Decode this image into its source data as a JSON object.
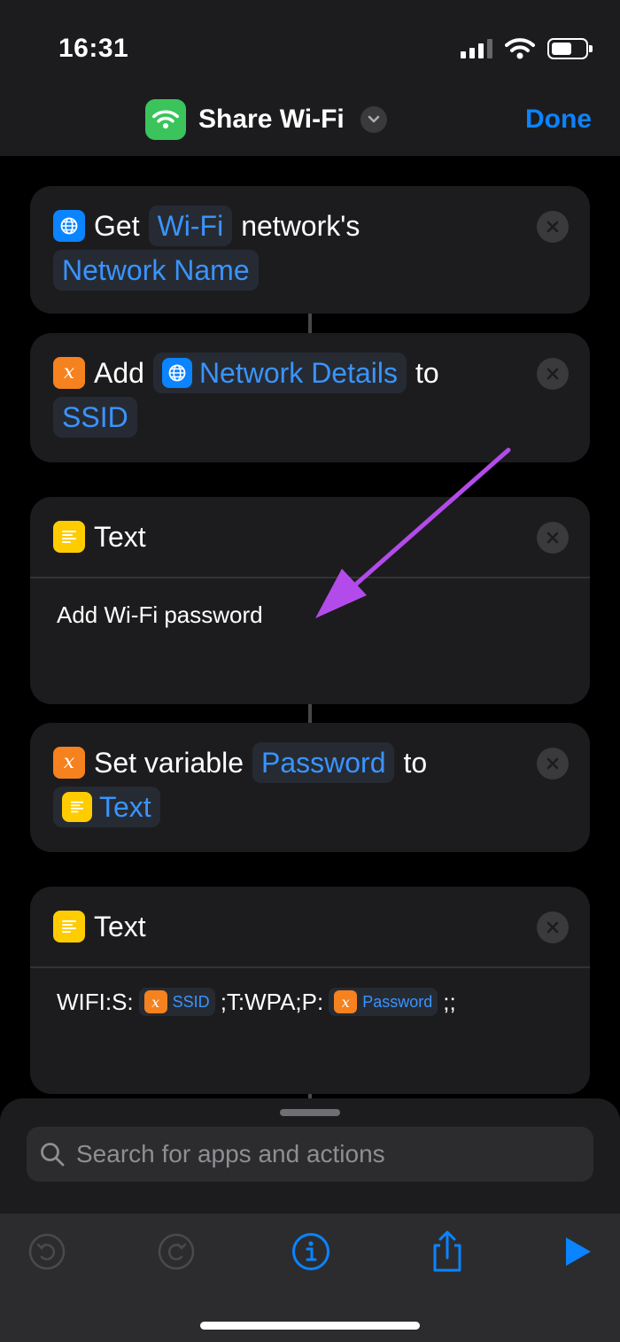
{
  "status": {
    "time": "16:31"
  },
  "nav": {
    "title": "Share Wi-Fi",
    "done_label": "Done"
  },
  "actions": [
    {
      "verb": "Get",
      "token1": "Wi-Fi",
      "mid": "network's",
      "token2": "Network Name"
    },
    {
      "verb": "Add",
      "token1": "Network Details",
      "mid": "to",
      "token2": "SSID"
    },
    {
      "title": "Text",
      "body": "Add Wi-Fi password"
    },
    {
      "verb": "Set variable",
      "token1": "Password",
      "mid": "to",
      "token2": "Text"
    },
    {
      "title": "Text",
      "body_prefix": "WIFI:S:",
      "body_var1": "SSID",
      "body_mid": ";T:WPA;P:",
      "body_var2": "Password",
      "body_suffix": ";;"
    }
  ],
  "search": {
    "placeholder": "Search for apps and actions"
  },
  "colors": {
    "accent": "#0a84ff",
    "variable": "#f5821f",
    "text_action": "#ffcc00",
    "annotation_arrow": "#b34bea",
    "app_icon": "#3ac45b"
  },
  "icons": [
    "wifi-icon",
    "chevron-down-icon",
    "globe-icon",
    "variable-icon",
    "text-icon",
    "close-icon",
    "search-icon",
    "undo-icon",
    "redo-icon",
    "info-icon",
    "share-icon",
    "play-icon"
  ]
}
